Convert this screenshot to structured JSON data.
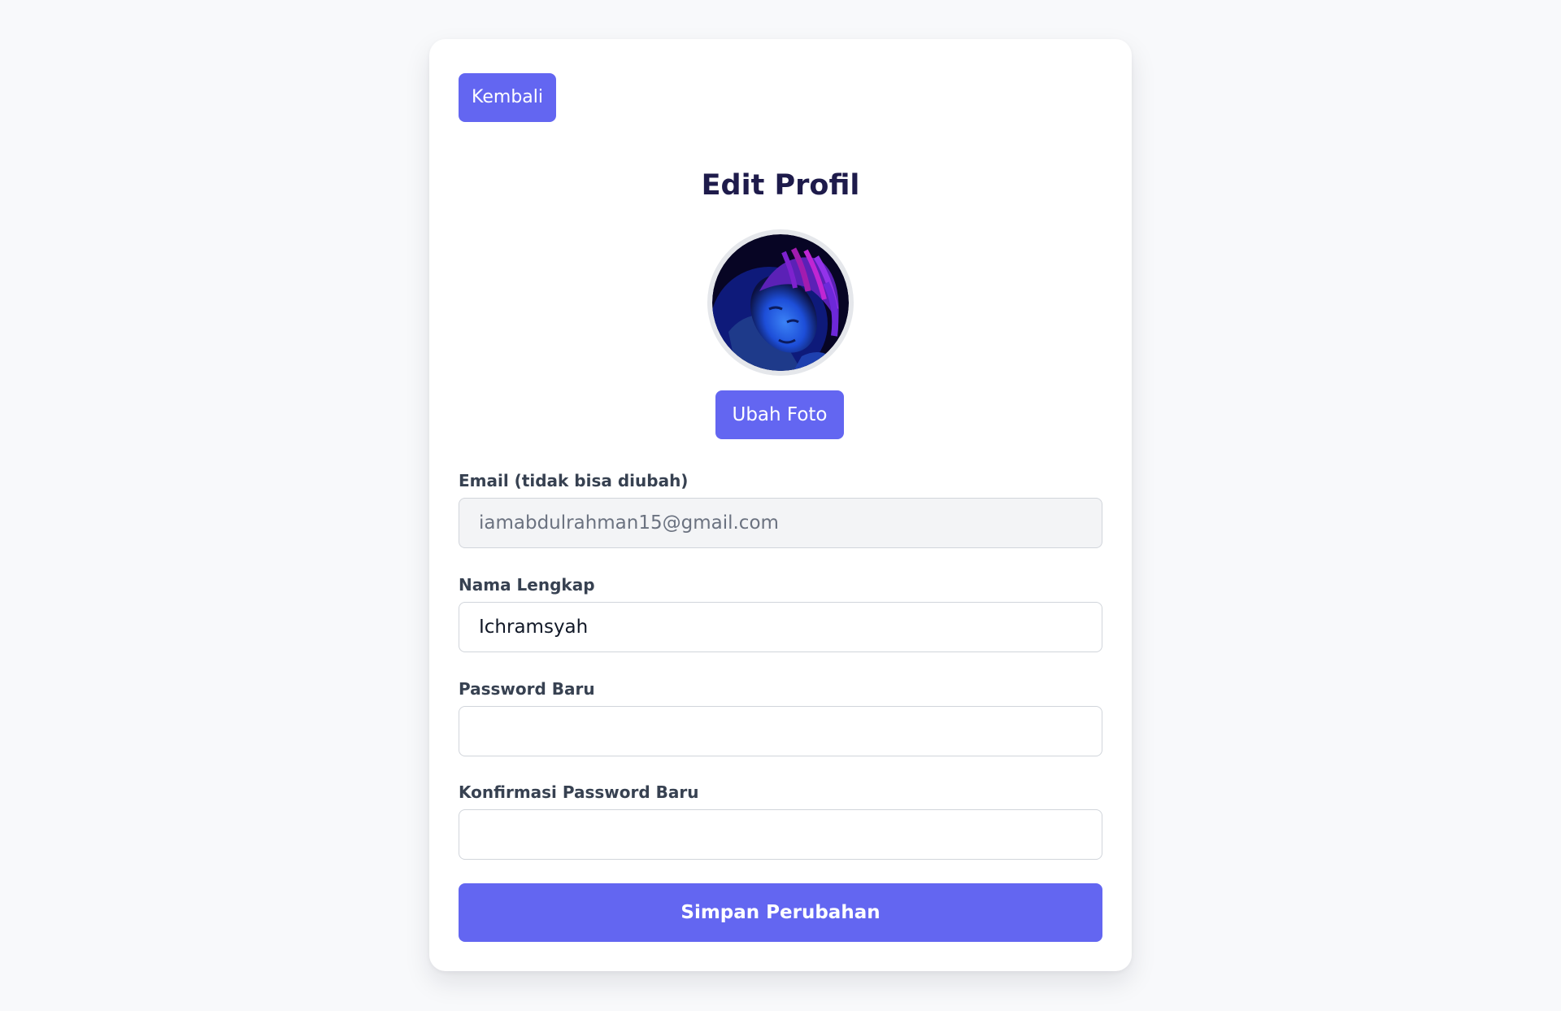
{
  "nav": {
    "back_label": "Kembali"
  },
  "profile": {
    "title": "Edit Profil",
    "avatar_icon": "profile-photo",
    "change_photo_label": "Ubah Foto"
  },
  "form": {
    "email": {
      "label": "Email (tidak bisa diubah)",
      "value": "iamabdulrahman15@gmail.com"
    },
    "full_name": {
      "label": "Nama Lengkap",
      "value": "Ichramsyah"
    },
    "new_password": {
      "label": "Password Baru",
      "value": ""
    },
    "confirm_password": {
      "label": "Konfirmasi Password Baru",
      "value": ""
    },
    "save_label": "Simpan Perubahan"
  },
  "colors": {
    "accent": "#6366f1",
    "title": "#1e1b4b",
    "background": "#f8f9fb"
  }
}
